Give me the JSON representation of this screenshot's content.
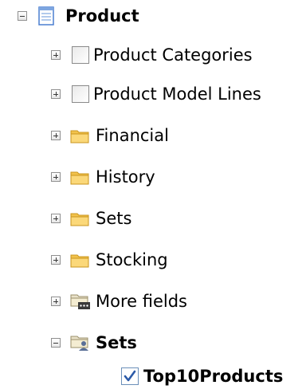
{
  "tree": {
    "root": {
      "label": "Product",
      "expanded": true
    },
    "items": [
      {
        "label": "Product Categories",
        "type": "checkbox",
        "checked": false
      },
      {
        "label": "Product Model Lines",
        "type": "checkbox",
        "checked": false
      },
      {
        "label": "Financial",
        "type": "folder"
      },
      {
        "label": "History",
        "type": "folder"
      },
      {
        "label": "Sets",
        "type": "folder"
      },
      {
        "label": "Stocking",
        "type": "folder"
      },
      {
        "label": "More fields",
        "type": "more-folder"
      }
    ],
    "sets": {
      "label": "Sets",
      "expanded": true,
      "children": [
        {
          "label": "Top10Products",
          "checked": true
        }
      ]
    }
  },
  "colors": {
    "folder": "#f2c24c",
    "check": "#2b5aa8",
    "table_icon": "#4a7fd0"
  }
}
